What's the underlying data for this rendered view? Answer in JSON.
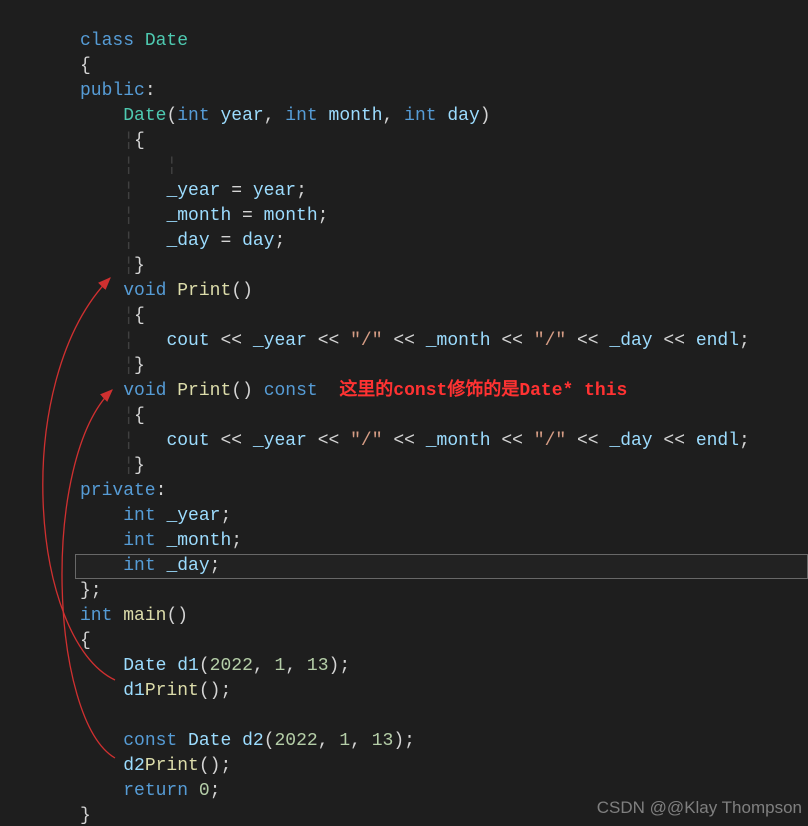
{
  "code": {
    "l0": {
      "class": "class",
      "date": "Date"
    },
    "l1": "{",
    "l2": {
      "public": "public",
      "colon": ":"
    },
    "l3": {
      "date": "Date",
      "lp": "(",
      "int1": "int",
      "p1": " year, ",
      "int2": "int",
      "p2": " month, ",
      "int3": "int",
      "p3": " day)",
      "year": "year",
      "month": "month",
      "day": "day"
    },
    "l4": "{",
    "l6": {
      "a": "_year = year;",
      "lhs": "_year",
      "eq": " = ",
      "rhs": "year",
      "sc": ";"
    },
    "l7": {
      "lhs": "_month",
      "eq": " = ",
      "rhs": "month",
      "sc": ";"
    },
    "l8": {
      "lhs": "_day",
      "eq": " = ",
      "rhs": "day",
      "sc": ";"
    },
    "l9": "}",
    "l10": {
      "void": "void",
      "print": "Print",
      "paren": "()"
    },
    "l11": "{",
    "l12": {
      "cout": "cout",
      "ll1": " << ",
      "y": "_year",
      "ll2": " << ",
      "s1": "\"/\"",
      "ll3": " << ",
      "m": "_month",
      "ll4": " << ",
      "s2": "\"/\"",
      "ll5": " << ",
      "d": "_day",
      "ll6": " << ",
      "endl": "endl",
      ";": ";"
    },
    "l13": "}",
    "l14": {
      "void": "void",
      "print": "Print",
      "paren": "()",
      "const": "const",
      "note": "这里的const修饰的是Date* this"
    },
    "l15": "{",
    "l16": {
      "cout": "cout",
      "ll1": " << ",
      "y": "_year",
      "ll2": " << ",
      "s1": "\"/\"",
      "ll3": " << ",
      "m": "_month",
      "ll4": " << ",
      "s2": "\"/\"",
      "ll5": " << ",
      "d": "_day",
      "ll6": " << ",
      "endl": "endl",
      ";": ";"
    },
    "l17": "}",
    "l18": {
      "private": "private",
      "colon": ":"
    },
    "l19": {
      "int": "int",
      "name": "_year",
      ";": ";"
    },
    "l20": {
      "int": "int",
      "name": "_month",
      ";": ";"
    },
    "l21": {
      "int": "int",
      "name": "_day",
      ";": ";"
    },
    "l22": "};",
    "l23": {
      "int": "int",
      "main": "main",
      "paren": "()"
    },
    "l24": "{",
    "l25": {
      "date": "Date",
      "d": "d1",
      "l": "(",
      "a": "2022",
      "c1": ", ",
      "b": "1",
      "c2": ", ",
      "c": "13",
      "r": ");"
    },
    "l26": {
      "d": "d1",
      ".": ".",
      "p": "Print",
      "paren": "();"
    },
    "l28": {
      "const": "const",
      "date": "Date",
      "d": "d2",
      "l": "(",
      "a": "2022",
      "c1": ", ",
      "b": "1",
      "c2": ", ",
      "c": "13",
      "r": ");"
    },
    "l29": {
      "d": "d2",
      ".": ".",
      "p": "Print",
      "paren": "();"
    },
    "l30": {
      "return": "return",
      "zero": "0",
      ";": ";"
    },
    "l31": "}"
  },
  "watermark": "CSDN @@Klay Thompson"
}
